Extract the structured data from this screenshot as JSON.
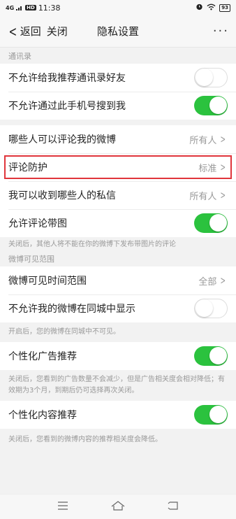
{
  "status_bar": {
    "network": "4G",
    "hd": "HD",
    "time": "11:38",
    "battery": "93"
  },
  "nav": {
    "back_label": "返回",
    "close_label": "关闭",
    "title": "隐私设置",
    "more": "···"
  },
  "contacts": {
    "header": "通讯录",
    "rows": [
      {
        "label": "不允许给我推荐通讯录好友",
        "toggle": "off"
      },
      {
        "label": "不允许通过此手机号搜到我",
        "toggle": "on"
      }
    ]
  },
  "comments": {
    "rows": [
      {
        "label": "哪些人可以评论我的微博",
        "value": "所有人"
      },
      {
        "label": "评论防护",
        "value": "标准"
      },
      {
        "label": "我可以收到哪些人的私信",
        "value": "所有人"
      },
      {
        "label": "允许评论带图",
        "toggle": "on"
      }
    ],
    "note": "关闭后，其他人将不能在你的微博下发布带图片的评论"
  },
  "visibility": {
    "header": "微博可见范围",
    "rows": [
      {
        "label": "微博可见时间范围",
        "value": "全部"
      },
      {
        "label": "不允许我的微博在同城中显示",
        "toggle": "off"
      }
    ],
    "note": "开启后，您的微博在同城中不可见。"
  },
  "ads": {
    "label": "个性化广告推荐",
    "toggle": "on",
    "note": "关闭后，您看到的广告数量不会减少，但是广告相关度会相对降低；有效期为3个月，到期后仍可选择再次关闭。"
  },
  "content": {
    "label": "个性化内容推荐",
    "toggle": "on",
    "note": "关闭后，您看到的微博内容的推荐相关度会降低。"
  },
  "colors": {
    "toggle_on": "#2bc23e",
    "highlight": "#e0353b"
  }
}
